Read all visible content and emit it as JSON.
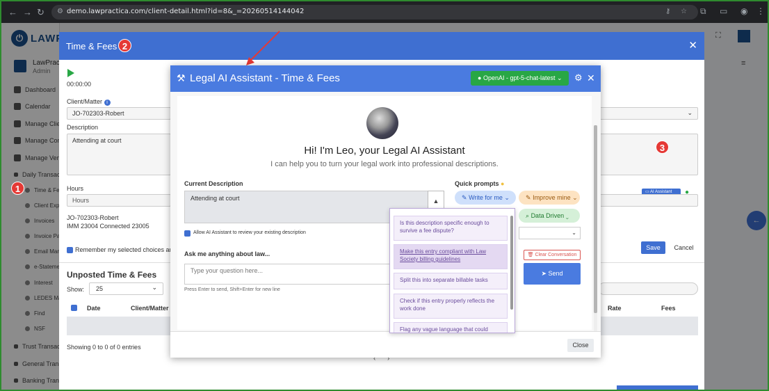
{
  "browser": {
    "url": "demo.lawpractica.com/client-detail.html?id=8&_=20260514144042"
  },
  "app": {
    "logo_text": "LAWP",
    "user_name": "LawPractica",
    "user_role": "Admin"
  },
  "sidebar": {
    "items": [
      {
        "label": "Dashboard"
      },
      {
        "label": "Calendar"
      },
      {
        "label": "Manage Clients"
      },
      {
        "label": "Manage Contacts"
      },
      {
        "label": "Manage Vendors"
      },
      {
        "label": "Daily Transactions"
      }
    ],
    "subitems": [
      {
        "label": "Time & Fees"
      },
      {
        "label": "Client Expenses"
      },
      {
        "label": "Invoices"
      },
      {
        "label": "Invoice Payments"
      },
      {
        "label": "Email Manager"
      },
      {
        "label": "e-Statements"
      },
      {
        "label": "Interest"
      },
      {
        "label": "LEDES Manager"
      },
      {
        "label": "Find"
      },
      {
        "label": "NSF"
      }
    ],
    "bottom_items": [
      {
        "label": "Trust Transactions"
      },
      {
        "label": "General Transactions"
      },
      {
        "label": "Banking Transactions"
      }
    ]
  },
  "badges": {
    "one": "1",
    "two": "2",
    "three": "3"
  },
  "time_fees": {
    "title": "Time & Fees",
    "timer": "00:00:00",
    "client_matter_label": "Client/Matter",
    "client_matter_value": "JO-702303-Robert",
    "description_label": "Description",
    "description_value": "Attending at court",
    "hours_label": "Hours",
    "hours_placeholder": "Hours",
    "client_line1": "JO-702303-Robert",
    "client_line2": "IMM 23004 Connected 23005",
    "remember_label": "Remember my selected choices and",
    "ai_assistant_label": "AI Assistant",
    "save_label": "Save",
    "cancel_label": "Cancel",
    "unposted_title": "Unposted Time & Fees",
    "show_label": "Show:",
    "show_value": "25",
    "columns": [
      "Date",
      "Client/Matter",
      "Rate",
      "Fees"
    ],
    "entries_text": "Showing 0 to 0 of 0 entries"
  },
  "ai_modal": {
    "title": "Legal AI Assistant - Time & Fees",
    "model": "OpenAI - gpt-5-chat-latest",
    "greeting": "Hi! I'm Leo, your Legal AI Assistant",
    "subgreeting": "I can help you to turn your legal work into professional descriptions.",
    "current_description_label": "Current Description",
    "current_description_value": "Attending at court",
    "allow_review_label": "Allow AI Assistant to review your existing description",
    "ask_label": "Ask me anything about law...",
    "ask_placeholder": "Type your question here...",
    "hint": "Press Enter to send, Shift+Enter for new line",
    "quick_prompts_label": "Quick prompts",
    "write_for_me": "Write for me",
    "improve_mine": "Improve mine",
    "data_driven": "Data Driven",
    "clear_conversation": "Clear Conversation",
    "send": "Send",
    "close": "Close",
    "dropdown_items": [
      "Is this description specific enough to survive a fee dispute?",
      "Make this entry compliant with Law Society billing guidelines",
      "Split this into separate billable tasks",
      "Check if this entry properly reflects the work done",
      "Flag any vague language that could"
    ]
  },
  "colors": {
    "header_blue": "#3f6fd1",
    "ai_blue": "#4a7be0",
    "model_green": "#28a745",
    "badge_red": "#e53935",
    "frame_green": "#2e8b2e"
  }
}
